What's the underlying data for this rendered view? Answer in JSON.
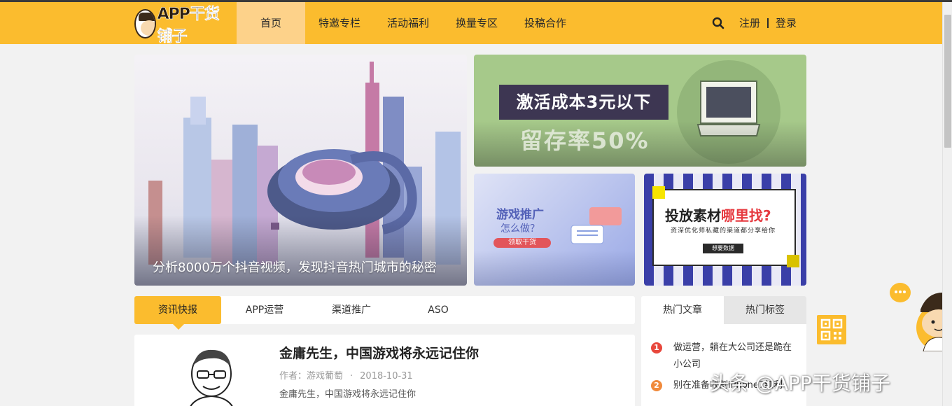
{
  "header": {
    "logo_text": "APP干货铺子",
    "nav": [
      {
        "label": "首页",
        "active": true
      },
      {
        "label": "特邀专栏",
        "active": false
      },
      {
        "label": "活动福利",
        "active": false
      },
      {
        "label": "换量专区",
        "active": false
      },
      {
        "label": "投稿合作",
        "active": false
      }
    ],
    "register": "注册",
    "login": "登录"
  },
  "banners": {
    "main_caption": "分析8000万个抖音视频，发现抖音热门城市的秘密",
    "top_title": "激活成本3元以下",
    "top_sub": "留存率50%",
    "left_title": "游戏推广",
    "left_sub": "怎么做？",
    "left_btn": "领取干货",
    "right_title_a": "投放素材",
    "right_title_b": "哪里找?",
    "right_sub": "资深优化师私藏的渠道都分享给你",
    "right_btn": "想要数据"
  },
  "tabs": [
    "资讯快报",
    "APP运营",
    "渠道推广",
    "ASO"
  ],
  "article": {
    "title": "金庸先生，中国游戏将永远记住你",
    "author": "作者：游戏葡萄",
    "dot": "·",
    "date": "2018-10-31",
    "desc": "金庸先生，中国游戏将永远记住你"
  },
  "sidebar": {
    "tabs": [
      "热门文章",
      "热门标签"
    ],
    "items": [
      {
        "num": "1",
        "text": "做运营，躺在大公司还是跪在小公司"
      },
      {
        "num": "2",
        "text": "别在准备收割iPhone7红利"
      }
    ]
  },
  "watermark": "头条 @APP干货铺子",
  "colors": {
    "accent": "#fbbc2e",
    "nav_active": "#fdd28a",
    "hot_red": "#e8473c"
  }
}
